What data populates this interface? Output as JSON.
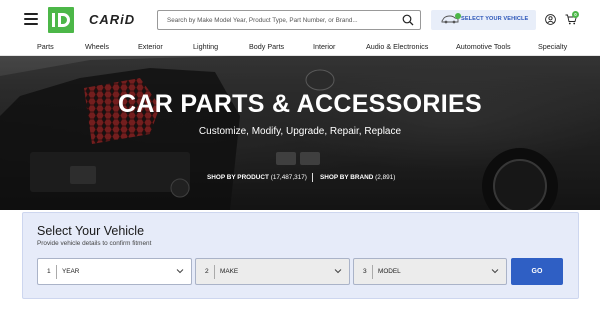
{
  "header": {
    "brand": "CARiD",
    "logo_letters": "iD",
    "search": {
      "placeholder": "Search by Make Model Year, Product Type, Part Number, or Brand..."
    },
    "vehicle_button_label": "SELECT YOUR VEHICLE",
    "cart_count": "0"
  },
  "nav": {
    "items": [
      "Parts",
      "Wheels",
      "Exterior",
      "Lighting",
      "Body Parts",
      "Interior",
      "Audio & Electronics",
      "Automotive Tools",
      "Specialty"
    ]
  },
  "hero": {
    "title": "CAR PARTS & ACCESSORIES",
    "subtitle": "Customize, Modify, Upgrade, Repair, Replace",
    "shop_by_product": {
      "label": "SHOP BY PRODUCT",
      "count": "(17,487,317)"
    },
    "shop_by_brand": {
      "label": "SHOP BY BRAND",
      "count": "(2,891)"
    }
  },
  "vehicle_selector": {
    "title": "Select Your Vehicle",
    "subtitle": "Provide vehicle details to confirm fitment",
    "fields": [
      {
        "number": "1",
        "label": "YEAR"
      },
      {
        "number": "2",
        "label": "MAKE"
      },
      {
        "number": "3",
        "label": "MODEL"
      }
    ],
    "go_label": "GO"
  },
  "colors": {
    "brand_green": "#4cb748",
    "accent_blue": "#2f5fc4",
    "panel_bg": "#e6ebf9"
  }
}
